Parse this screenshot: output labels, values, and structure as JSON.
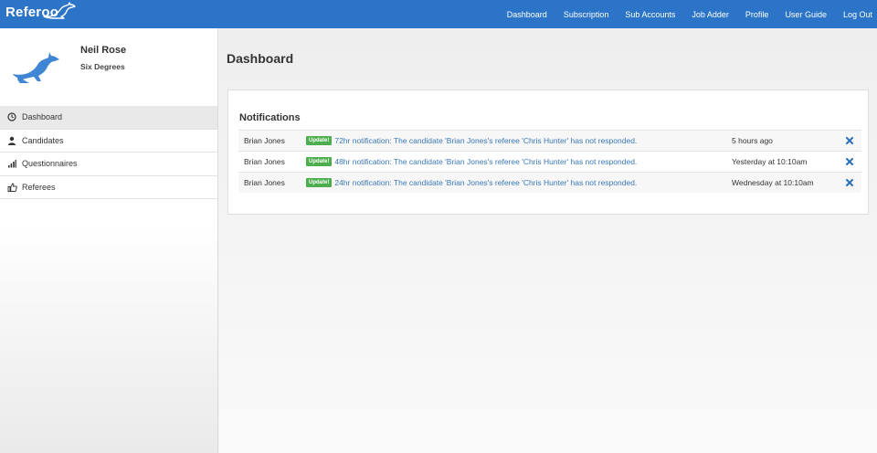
{
  "app": {
    "brand": "Referoo",
    "brand_color": "#2b74c7"
  },
  "nav": {
    "items": [
      "Dashboard",
      "Subscription",
      "Sub Accounts",
      "Job Adder",
      "Profile",
      "User Guide",
      "Log Out"
    ]
  },
  "profile": {
    "name": "Neil Rose",
    "company": "Six Degrees",
    "avatar_icon": "kangaroo-icon"
  },
  "sidebar": {
    "items": [
      {
        "label": "Dashboard",
        "icon": "dashboard-icon",
        "active": true
      },
      {
        "label": "Candidates",
        "icon": "user-icon",
        "active": false
      },
      {
        "label": "Questionnaires",
        "icon": "bar-chart-icon",
        "active": false
      },
      {
        "label": "Referees",
        "icon": "thumbs-up-icon",
        "active": false
      }
    ]
  },
  "main": {
    "title": "Dashboard",
    "notifications": {
      "title": "Notifications",
      "rows": [
        {
          "name": "Brian Jones",
          "badge": "Update!",
          "message": "72hr notification: The candidate 'Brian Jones's referee 'Chris Hunter' has not responded.",
          "time": "5 hours ago"
        },
        {
          "name": "Brian Jones",
          "badge": "Update!",
          "message": "48hr notification: The candidate 'Brian Jones's referee 'Chris Hunter' has not responded.",
          "time": "Yesterday at 10:10am"
        },
        {
          "name": "Brian Jones",
          "badge": "Update!",
          "message": "24hr notification: The candidate 'Brian Jones's referee 'Chris Hunter' has not responded.",
          "time": "Wednesday at 10:10am"
        }
      ]
    }
  }
}
